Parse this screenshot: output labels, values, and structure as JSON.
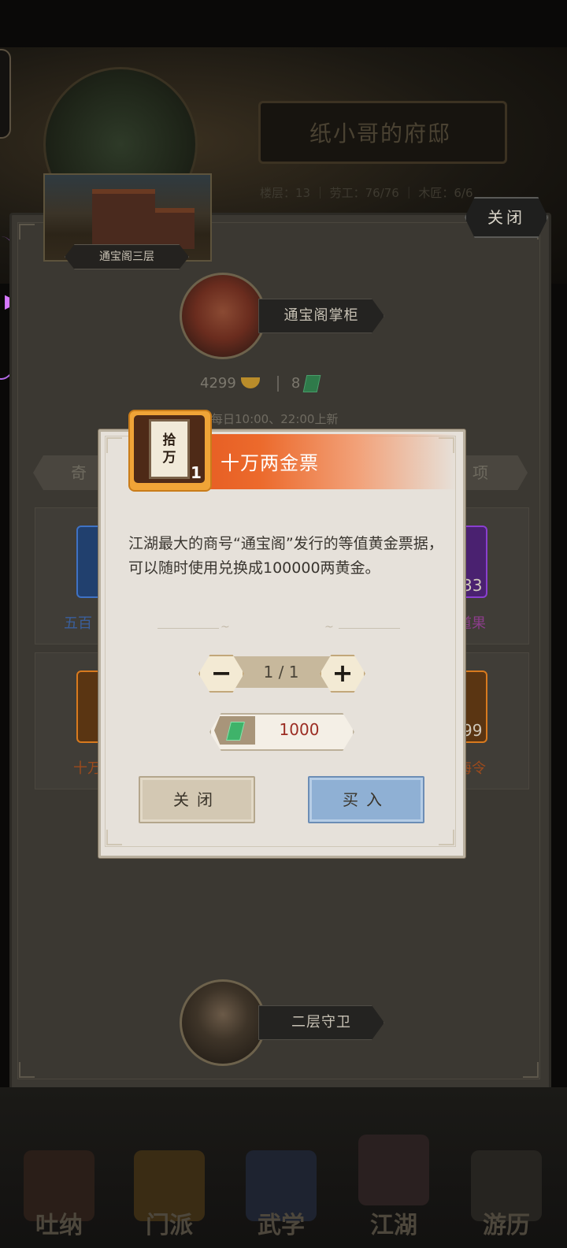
{
  "mansion": {
    "title": "纸小哥的府邸",
    "stats": "楼层：13 ｜ 劳工：76/76 ｜ 木匠：6/6"
  },
  "top_close_label": "关闭",
  "floor": {
    "label": "通宝阁三层"
  },
  "keeper": {
    "name": "通宝阁掌柜"
  },
  "currency": {
    "gold": "4299",
    "jade": "8"
  },
  "refresh_note": "每日10:00、22:00上新",
  "tabs": {
    "left": "奇",
    "right": "项"
  },
  "shop_items": [
    {
      "label": "五百",
      "color": "#3f72c4"
    },
    {
      "label": "道果",
      "badge": "33",
      "color": "#8a3fd0"
    },
    {
      "label": "十万",
      "color": "#d87a1e"
    },
    {
      "label": "海令",
      "badge": "99",
      "color": "#d87a1e"
    }
  ],
  "guard": {
    "name": "二层守卫"
  },
  "bottom_nav": [
    "吐纳",
    "门派",
    "武学",
    "江湖",
    "游历"
  ],
  "dialog": {
    "title": "十万两金票",
    "item_glyph_top": "拾",
    "item_glyph_bottom": "万",
    "item_count": "1",
    "description": "江湖最大的商号“通宝阁”发行的等值黄金票据，可以随时使用兑换成100000两黄金。",
    "quantity": "1 / 1",
    "minus_symbol": "−",
    "plus_symbol": "+",
    "price": "1000",
    "close_label": "关闭",
    "buy_label": "买入"
  },
  "colors": {
    "header_orange": "#e0501a",
    "buy_button": "#8fb0d4",
    "price_red": "#9b2c22"
  }
}
